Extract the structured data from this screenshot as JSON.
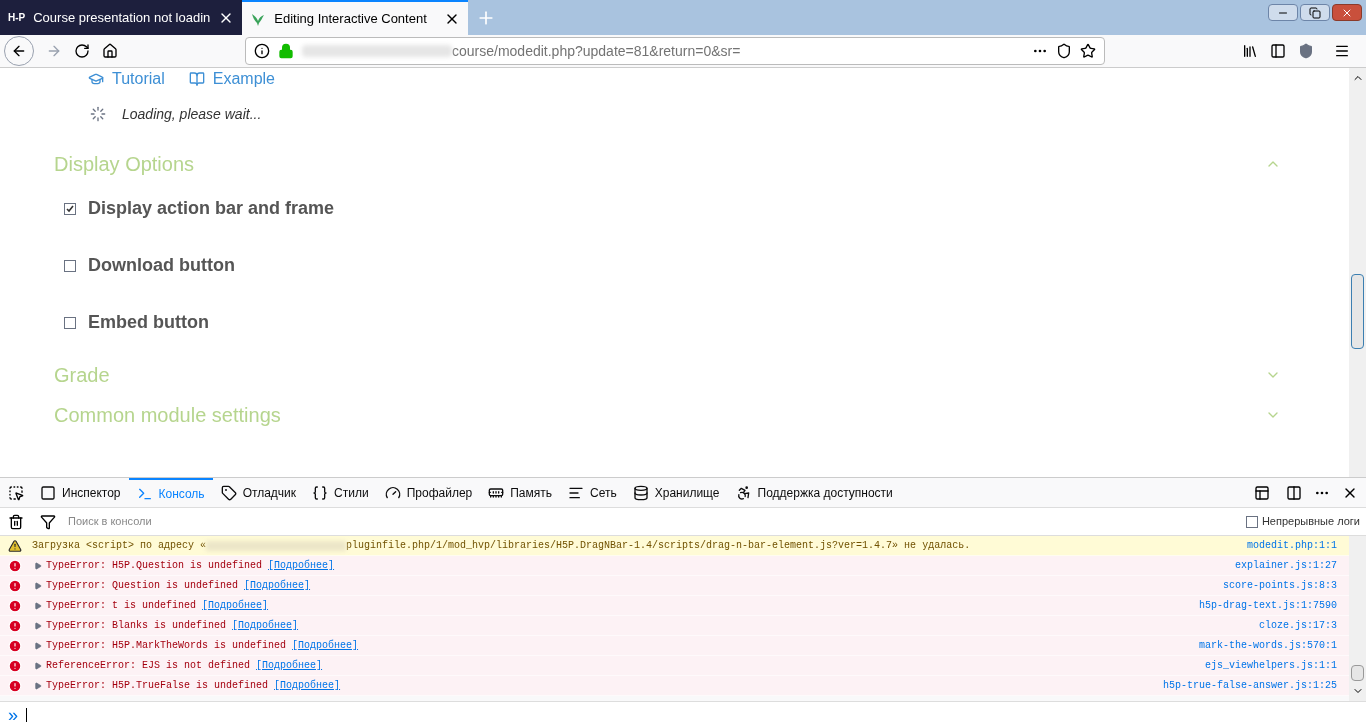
{
  "browser_tabs": [
    {
      "favicon": "H-P",
      "title": "Course presentation not loadin",
      "selected": false
    },
    {
      "title": "Editing Interactive Content",
      "selected": true
    }
  ],
  "address_bar": {
    "url": "course/modedit.php?update=81&return=0&sr="
  },
  "page": {
    "links": [
      "Tutorial",
      "Example"
    ],
    "loading": "Loading, please wait...",
    "sections": [
      {
        "title": "Display Options",
        "expanded": true,
        "options": [
          {
            "label": "Display action bar and frame",
            "checked": true
          },
          {
            "label": "Download button",
            "checked": false
          },
          {
            "label": "Embed button",
            "checked": false
          }
        ]
      },
      {
        "title": "Grade",
        "expanded": false
      },
      {
        "title": "Common module settings",
        "expanded": false
      }
    ]
  },
  "devtools": {
    "tabs": [
      {
        "label": "Инспектор",
        "selected": false
      },
      {
        "label": "Консоль",
        "selected": true
      },
      {
        "label": "Отладчик",
        "selected": false
      },
      {
        "label": "Стили",
        "selected": false
      },
      {
        "label": "Профайлер",
        "selected": false
      },
      {
        "label": "Память",
        "selected": false
      },
      {
        "label": "Сеть",
        "selected": false
      },
      {
        "label": "Хранилище",
        "selected": false
      },
      {
        "label": "Поддержка доступности",
        "selected": false
      }
    ],
    "filter": {
      "placeholder": "Поиск в консоли"
    },
    "persist_logs": {
      "label": "Непрерывные логи",
      "checked": false
    },
    "messages": [
      {
        "kind": "warning",
        "text": "Загрузка <script> по адресу «",
        "text_after": "pluginfile.php/1/mod_hvp/libraries/H5P.DragNBar-1.4/scripts/drag-n-bar-element.js?ver=1.4.7» не удалась.",
        "source": "modedit.php:1:1"
      },
      {
        "kind": "error",
        "text": "TypeError: H5P.Question is undefined",
        "more": "[Подробнее]",
        "source": "explainer.js:1:27"
      },
      {
        "kind": "error",
        "text": "TypeError: Question is undefined",
        "more": "[Подробнее]",
        "source": "score-points.js:8:3"
      },
      {
        "kind": "error",
        "text": "TypeError: t is undefined",
        "more": "[Подробнее]",
        "source": "h5p-drag-text.js:1:7590"
      },
      {
        "kind": "error",
        "text": "TypeError: Blanks is undefined",
        "more": "[Подробнее]",
        "source": "cloze.js:17:3"
      },
      {
        "kind": "error",
        "text": "TypeError: H5P.MarkTheWords is undefined",
        "more": "[Подробнее]",
        "source": "mark-the-words.js:570:1"
      },
      {
        "kind": "error",
        "text": "ReferenceError: EJS is not defined",
        "more": "[Подробнее]",
        "source": "ejs_viewhelpers.js:1:1"
      },
      {
        "kind": "error",
        "text": "TypeError: H5P.TrueFalse is undefined",
        "more": "[Подробнее]",
        "source": "h5p-true-false-answer.js:1:25"
      }
    ],
    "prompt": "»"
  }
}
